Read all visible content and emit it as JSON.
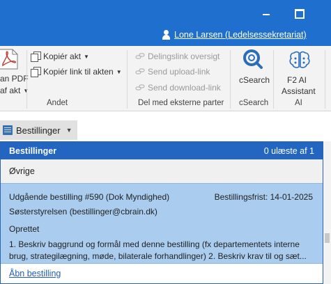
{
  "window": {
    "user_name": "Lone Larsen (Ledelsessekretariat)",
    "minimize_icon": "minimize-icon",
    "maximize_icon": "maximize-icon"
  },
  "ribbon": {
    "pdf": {
      "line1": "an PDF",
      "line2": "af akt"
    },
    "andet": {
      "copy_act": "Kopiér akt",
      "copy_link": "Kopiér link til akten",
      "group_label": "Andet"
    },
    "share": {
      "overview": "Delingslink oversigt",
      "upload": "Send upload-link",
      "download": "Send download-link",
      "group_label": "Del med eksterne parter"
    },
    "csearch": {
      "label": "cSearch",
      "group_label": "cSearch"
    },
    "ai": {
      "line1": "F2 AI",
      "line2": "Assistant",
      "group_label": "AI"
    }
  },
  "folder_dropdown": {
    "label": "Bestillinger"
  },
  "panel": {
    "title": "Bestillinger",
    "count": "0 ulæste af 1",
    "section": "Øvrige",
    "card": {
      "title": "Udgående bestilling #590 (Dok Myndighed)",
      "deadline": "Bestillingsfrist: 14-01-2025",
      "sender": "Søsterstyrelsen (bestillinger@cbrain.dk)",
      "status": "Oprettet",
      "desc_line1": "1. Beskriv baggrund og formål med denne bestilling (fx departementets interne",
      "desc_line2": "brug, strategilægning, møde, bilaterale forhandlinger)  2. Beskriv krav til og sæt..."
    },
    "open_link": "Åbn bestilling"
  },
  "colors": {
    "titlebar": "#1f6fcf",
    "panel_header": "#2266c1",
    "card_selected": "#a9ccef",
    "link": "#1f5fb8"
  }
}
